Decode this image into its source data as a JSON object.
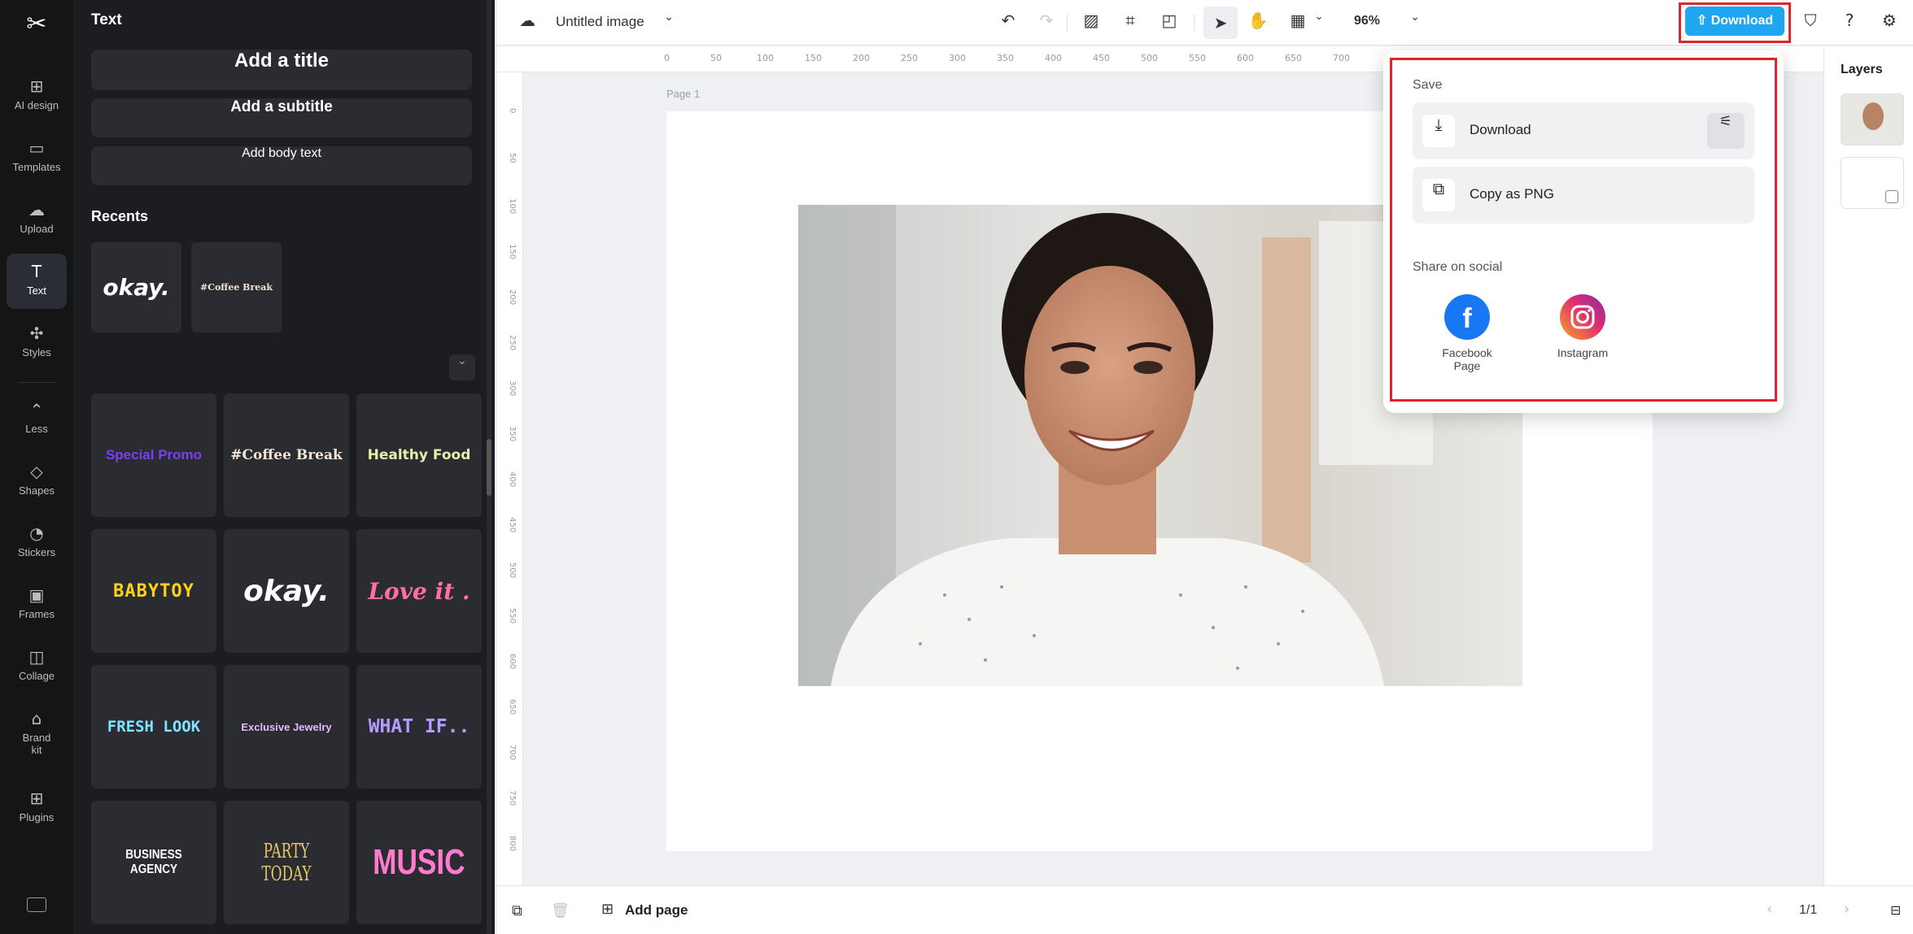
{
  "rail": {
    "logo": "✂",
    "items": [
      {
        "label": "AI design",
        "icon": "ai-design-icon"
      },
      {
        "label": "Templates",
        "icon": "templates-icon"
      },
      {
        "label": "Upload",
        "icon": "upload-icon"
      },
      {
        "label": "Text",
        "icon": "text-icon"
      },
      {
        "label": "Styles",
        "icon": "styles-icon"
      },
      {
        "label": "Less",
        "icon": "chevron-up-icon"
      },
      {
        "label": "Shapes",
        "icon": "shapes-icon"
      },
      {
        "label": "Stickers",
        "icon": "stickers-icon"
      },
      {
        "label": "Frames",
        "icon": "frames-icon"
      },
      {
        "label": "Collage",
        "icon": "collage-icon"
      },
      {
        "label": "Brand\nkit",
        "icon": "brand-kit-icon"
      },
      {
        "label": "Plugins",
        "icon": "plugins-icon"
      }
    ]
  },
  "panel": {
    "title": "Text",
    "add_title": "Add a title",
    "add_subtitle": "Add a subtitle",
    "add_body": "Add body text",
    "recents_title": "Recents",
    "recents": [
      "okay.",
      "#Coffee Break"
    ],
    "tiles": [
      {
        "text": "Special Promo",
        "color": "#7b3ff2"
      },
      {
        "text": "#Coffee Break",
        "color": "#f3e6d6"
      },
      {
        "text": "Healthy Food",
        "color": "#e8f0a6"
      },
      {
        "text": "BABYTOY",
        "color": "#ffd21a"
      },
      {
        "text": "okay.",
        "color": "#ffffff"
      },
      {
        "text": "Love it .",
        "color": "#ff6fa0"
      },
      {
        "text": "FRESH LOOK",
        "color": "#7fe3ff"
      },
      {
        "text": "Exclusive Jewelry",
        "color": "#e7b8ff"
      },
      {
        "text": "WHAT IF..",
        "color": "#b89bff"
      },
      {
        "text": "BUSINESS AGENCY",
        "color": "#ffffff"
      },
      {
        "text": "PARTY TODAY",
        "color": "#e9c86a"
      },
      {
        "text": "MUSIC",
        "color": "#ff7bd0"
      }
    ]
  },
  "topbar": {
    "doc_title": "Untitled image",
    "zoom": "96%",
    "download_label": "Download"
  },
  "ruler": {
    "top": [
      "0",
      "50",
      "100",
      "150",
      "200",
      "250",
      "300",
      "350",
      "400",
      "450",
      "500",
      "550",
      "600",
      "650",
      "700"
    ],
    "left": [
      "0",
      "50",
      "100",
      "150",
      "200",
      "250",
      "300",
      "350",
      "400",
      "450",
      "500",
      "550",
      "600",
      "650",
      "700",
      "750",
      "800"
    ]
  },
  "canvas": {
    "page_label": "Page 1"
  },
  "layers": {
    "title": "Layers"
  },
  "bottombar": {
    "add_page": "Add page",
    "page_count": "1/1"
  },
  "dropdown": {
    "save_section": "Save",
    "download": "Download",
    "copy_png": "Copy as PNG",
    "share_section": "Share on social",
    "facebook": "Facebook Page",
    "instagram": "Instagram"
  },
  "colors": {
    "accent": "#1ea7f0",
    "highlight": "#e0242c"
  }
}
